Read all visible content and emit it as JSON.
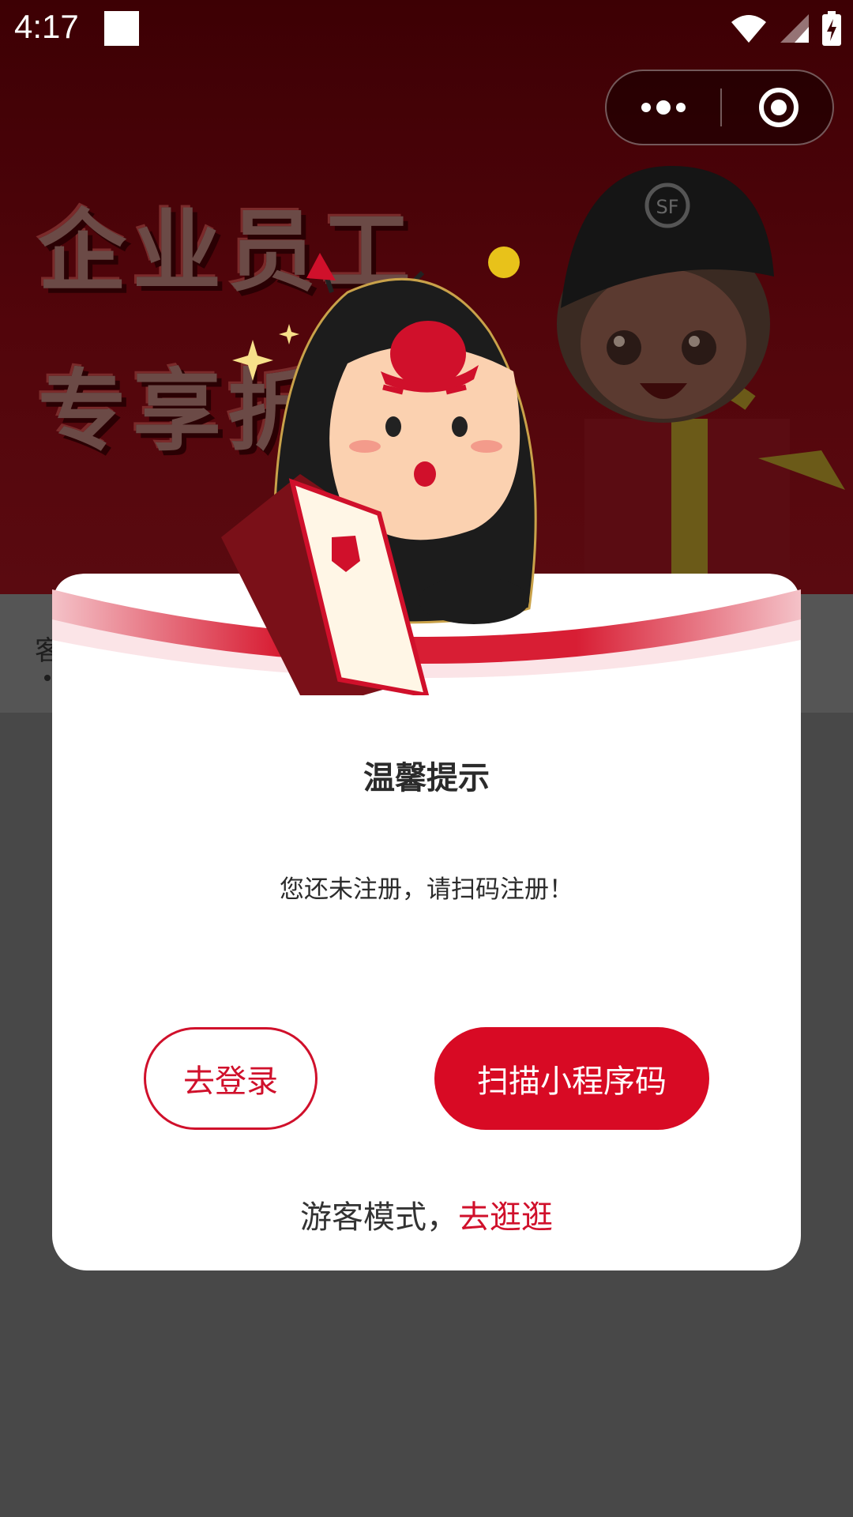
{
  "status_bar": {
    "time": "4:17",
    "icons": [
      "notification-icon",
      "wifi-icon",
      "signal-icon",
      "battery-charging-icon"
    ]
  },
  "background": {
    "headline_line1": "企业员工",
    "headline_line2": "专享折",
    "lower_label": "客"
  },
  "capsule": {
    "more_icon": "more-dots-icon",
    "close_icon": "target-circle-icon"
  },
  "modal": {
    "title": "温馨提示",
    "message": "您还未注册，请扫码注册！",
    "login_button": "去登录",
    "scan_button": "扫描小程序码",
    "guest_prefix": "游客模式，",
    "guest_link": "去逛逛"
  },
  "colors": {
    "accent": "#d80a24",
    "banner_bg": "#3d0004",
    "overlay_bg": "#484848"
  }
}
